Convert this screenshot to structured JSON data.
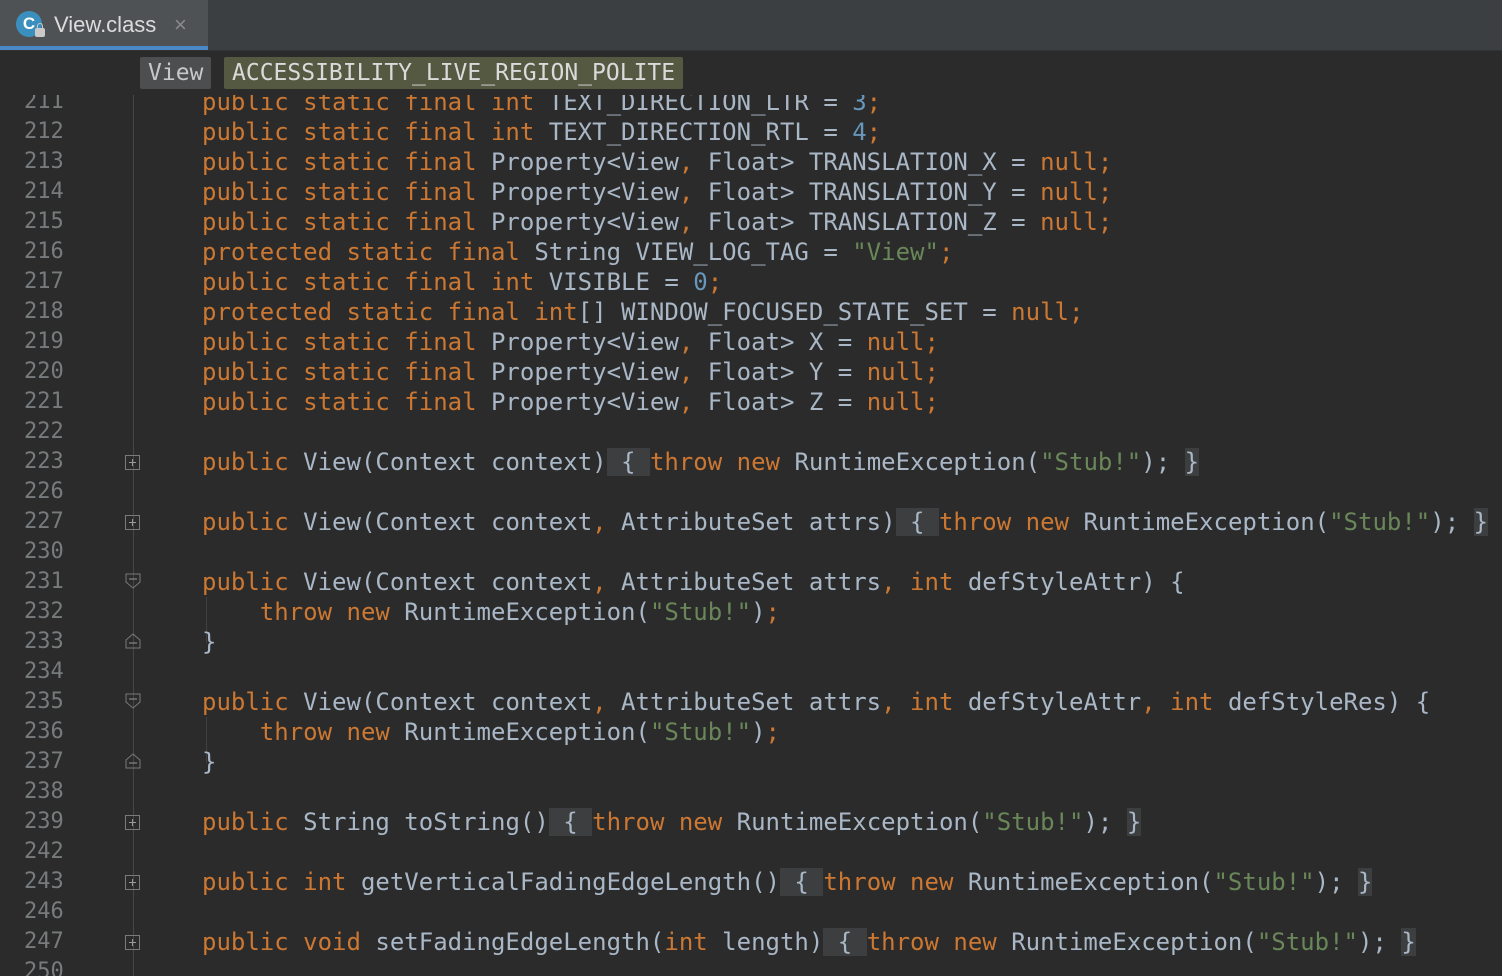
{
  "tab": {
    "title": "View.class",
    "icon_letter": "C",
    "close": "×"
  },
  "breadcrumb": {
    "class_name": "View",
    "field_name": "ACCESSIBILITY_LIVE_REGION_POLITE"
  },
  "colors": {
    "keyword": "#cc7832",
    "number": "#6897bb",
    "string": "#6a8759",
    "text": "#a9b7c6",
    "background": "#2b2b2b"
  },
  "lines": [
    {
      "n": "211",
      "tokens": [
        [
          "kw",
          "public static final int "
        ],
        [
          "",
          "TEXT_DIRECTION_LTR = "
        ],
        [
          "num",
          "3"
        ],
        [
          "kw",
          ";"
        ]
      ]
    },
    {
      "n": "212",
      "tokens": [
        [
          "kw",
          "public static final int "
        ],
        [
          "",
          "TEXT_DIRECTION_RTL = "
        ],
        [
          "num",
          "4"
        ],
        [
          "kw",
          ";"
        ]
      ]
    },
    {
      "n": "213",
      "tokens": [
        [
          "kw",
          "public static final "
        ],
        [
          "",
          "Property<View"
        ],
        [
          "kw",
          ", "
        ],
        [
          "",
          "Float> TRANSLATION_X = "
        ],
        [
          "kw",
          "null;"
        ]
      ]
    },
    {
      "n": "214",
      "tokens": [
        [
          "kw",
          "public static final "
        ],
        [
          "",
          "Property<View"
        ],
        [
          "kw",
          ", "
        ],
        [
          "",
          "Float> TRANSLATION_Y = "
        ],
        [
          "kw",
          "null;"
        ]
      ]
    },
    {
      "n": "215",
      "tokens": [
        [
          "kw",
          "public static final "
        ],
        [
          "",
          "Property<View"
        ],
        [
          "kw",
          ", "
        ],
        [
          "",
          "Float> TRANSLATION_Z = "
        ],
        [
          "kw",
          "null;"
        ]
      ]
    },
    {
      "n": "216",
      "tokens": [
        [
          "kw",
          "protected static final "
        ],
        [
          "",
          "String VIEW_LOG_TAG = "
        ],
        [
          "str",
          "\"View\""
        ],
        [
          "kw",
          ";"
        ]
      ]
    },
    {
      "n": "217",
      "tokens": [
        [
          "kw",
          "public static final int "
        ],
        [
          "",
          "VISIBLE = "
        ],
        [
          "num",
          "0"
        ],
        [
          "kw",
          ";"
        ]
      ]
    },
    {
      "n": "218",
      "tokens": [
        [
          "kw",
          "protected static final int"
        ],
        [
          "",
          "[] WINDOW_FOCUSED_STATE_SET = "
        ],
        [
          "kw",
          "null;"
        ]
      ]
    },
    {
      "n": "219",
      "tokens": [
        [
          "kw",
          "public static final "
        ],
        [
          "",
          "Property<View"
        ],
        [
          "kw",
          ", "
        ],
        [
          "",
          "Float> X = "
        ],
        [
          "kw",
          "null;"
        ]
      ]
    },
    {
      "n": "220",
      "tokens": [
        [
          "kw",
          "public static final "
        ],
        [
          "",
          "Property<View"
        ],
        [
          "kw",
          ", "
        ],
        [
          "",
          "Float> Y = "
        ],
        [
          "kw",
          "null;"
        ]
      ]
    },
    {
      "n": "221",
      "tokens": [
        [
          "kw",
          "public static final "
        ],
        [
          "",
          "Property<View"
        ],
        [
          "kw",
          ", "
        ],
        [
          "",
          "Float> Z = "
        ],
        [
          "kw",
          "null;"
        ]
      ]
    },
    {
      "n": "222",
      "tokens": []
    },
    {
      "n": "223",
      "fold": "plus",
      "tokens": [
        [
          "kw",
          "public "
        ],
        [
          "",
          "View(Context context)"
        ],
        [
          "fold",
          " { "
        ],
        [
          "kw",
          "throw new "
        ],
        [
          "",
          "RuntimeException("
        ],
        [
          "str",
          "\"Stub!\""
        ],
        [
          "",
          "); "
        ],
        [
          "fold",
          "}"
        ]
      ]
    },
    {
      "n": "226",
      "tokens": []
    },
    {
      "n": "227",
      "fold": "plus",
      "tokens": [
        [
          "kw",
          "public "
        ],
        [
          "",
          "View(Context context"
        ],
        [
          "kw",
          ", "
        ],
        [
          "",
          "AttributeSet attrs)"
        ],
        [
          "fold",
          " { "
        ],
        [
          "kw",
          "throw new "
        ],
        [
          "",
          "RuntimeException("
        ],
        [
          "str",
          "\"Stub!\""
        ],
        [
          "",
          "); "
        ],
        [
          "fold",
          "}"
        ]
      ]
    },
    {
      "n": "230",
      "tokens": []
    },
    {
      "n": "231",
      "fold": "open",
      "tokens": [
        [
          "kw",
          "public "
        ],
        [
          "",
          "View(Context context"
        ],
        [
          "kw",
          ", "
        ],
        [
          "",
          "AttributeSet attrs"
        ],
        [
          "kw",
          ", int "
        ],
        [
          "",
          "defStyleAttr) {"
        ]
      ]
    },
    {
      "n": "232",
      "tokens": [
        [
          "",
          "    "
        ],
        [
          "kw",
          "throw new "
        ],
        [
          "",
          "RuntimeException("
        ],
        [
          "str",
          "\"Stub!\""
        ],
        [
          "",
          ")"
        ],
        [
          "kw",
          ";"
        ]
      ]
    },
    {
      "n": "233",
      "fold": "close",
      "tokens": [
        [
          "",
          "}"
        ]
      ]
    },
    {
      "n": "234",
      "tokens": []
    },
    {
      "n": "235",
      "fold": "open",
      "tokens": [
        [
          "kw",
          "public "
        ],
        [
          "",
          "View(Context context"
        ],
        [
          "kw",
          ", "
        ],
        [
          "",
          "AttributeSet attrs"
        ],
        [
          "kw",
          ", int "
        ],
        [
          "",
          "defStyleAttr"
        ],
        [
          "kw",
          ", int "
        ],
        [
          "",
          "defStyleRes) {"
        ]
      ]
    },
    {
      "n": "236",
      "tokens": [
        [
          "",
          "    "
        ],
        [
          "kw",
          "throw new "
        ],
        [
          "",
          "RuntimeException("
        ],
        [
          "str",
          "\"Stub!\""
        ],
        [
          "",
          ")"
        ],
        [
          "kw",
          ";"
        ]
      ]
    },
    {
      "n": "237",
      "fold": "close",
      "tokens": [
        [
          "",
          "}"
        ]
      ]
    },
    {
      "n": "238",
      "tokens": []
    },
    {
      "n": "239",
      "fold": "plus",
      "tokens": [
        [
          "kw",
          "public "
        ],
        [
          "",
          "String toString()"
        ],
        [
          "fold",
          " { "
        ],
        [
          "kw",
          "throw new "
        ],
        [
          "",
          "RuntimeException("
        ],
        [
          "str",
          "\"Stub!\""
        ],
        [
          "",
          "); "
        ],
        [
          "fold",
          "}"
        ]
      ]
    },
    {
      "n": "242",
      "tokens": []
    },
    {
      "n": "243",
      "fold": "plus",
      "tokens": [
        [
          "kw",
          "public int "
        ],
        [
          "",
          "getVerticalFadingEdgeLength()"
        ],
        [
          "fold",
          " { "
        ],
        [
          "kw",
          "throw new "
        ],
        [
          "",
          "RuntimeException("
        ],
        [
          "str",
          "\"Stub!\""
        ],
        [
          "",
          "); "
        ],
        [
          "fold",
          "}"
        ]
      ]
    },
    {
      "n": "246",
      "tokens": []
    },
    {
      "n": "247",
      "fold": "plus",
      "tokens": [
        [
          "kw",
          "public void "
        ],
        [
          "",
          "setFadingEdgeLength("
        ],
        [
          "kw",
          "int "
        ],
        [
          "",
          "length)"
        ],
        [
          "fold",
          " { "
        ],
        [
          "kw",
          "throw new "
        ],
        [
          "",
          "RuntimeException("
        ],
        [
          "str",
          "\"Stub!\""
        ],
        [
          "",
          "); "
        ],
        [
          "fold",
          "}"
        ]
      ]
    },
    {
      "n": "250",
      "tokens": []
    }
  ]
}
